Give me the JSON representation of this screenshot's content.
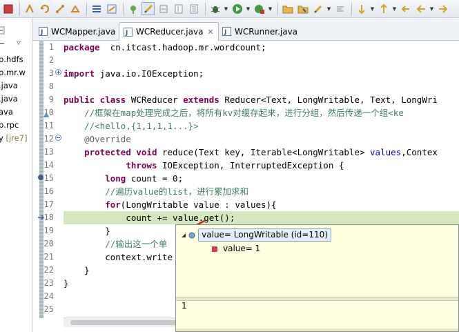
{
  "toolbar": {
    "icons": [
      "stop-icon",
      "build-icon",
      "refresh-icon",
      "link-icon",
      "debug-icon",
      "build-all-icon",
      "skip-breakpoints-icon",
      "toggle-comment-icon",
      "run-icon",
      "run-external-icon",
      "open-type-icon",
      "open-task-icon",
      "search-icon",
      "mark-occurrences-icon",
      "next-annotation-icon",
      "previous-annotation-icon",
      "back-icon",
      "forward-icon"
    ]
  },
  "explorer": {
    "items": [
      {
        "label": "p.hdfs",
        "suffix": ""
      },
      {
        "label": "p.mr.w",
        "suffix": ""
      },
      {
        "label": ".java",
        "suffix": ""
      },
      {
        "label": ".java",
        "suffix": ""
      },
      {
        "label": "ava",
        "suffix": ""
      },
      {
        "label": "p.rpc",
        "suffix": ""
      },
      {
        "label": "y ",
        "suffix": "[jre7]"
      }
    ]
  },
  "tabs": [
    {
      "label": "WCMapper.java",
      "active": false
    },
    {
      "label": "WCReducer.java",
      "active": true,
      "close": "✕"
    },
    {
      "label": "WCRunner.java",
      "active": false
    }
  ],
  "editor": {
    "line_numbers": [
      "1",
      "2",
      "3",
      "8",
      "9",
      "10",
      "11",
      "12",
      "13",
      "14",
      "15",
      "16",
      "17",
      "18",
      "19",
      "20",
      "21",
      "22",
      "23",
      "24",
      "25"
    ],
    "lines": [
      {
        "n": "1",
        "parts": [
          [
            "kw",
            "package"
          ],
          [
            "",
            "  cn.itcast.hadoop.mr.wordcount;"
          ]
        ]
      },
      {
        "n": "2",
        "parts": []
      },
      {
        "n": "3",
        "parts": [
          [
            "kw",
            "import"
          ],
          [
            "",
            " java.io.IOException;"
          ]
        ]
      },
      {
        "n": "8",
        "parts": []
      },
      {
        "n": "9",
        "parts": [
          [
            "kw",
            "public class"
          ],
          [
            "",
            " WCReducer "
          ],
          [
            "kw",
            "extends"
          ],
          [
            "",
            " Reducer<Text, LongWritable, Text, LongWri"
          ]
        ]
      },
      {
        "n": "10",
        "parts": [
          [
            "cm",
            "    //框架在map处理完成之后，将所有kv对缓存起来，进行分组，然后传递一个组<ke"
          ]
        ]
      },
      {
        "n": "11",
        "parts": [
          [
            "cm",
            "    //<hello,{1,1,1,1...}>"
          ]
        ]
      },
      {
        "n": "12",
        "parts": [
          [
            "an",
            "    @Override"
          ]
        ]
      },
      {
        "n": "13",
        "parts": [
          [
            "",
            "    "
          ],
          [
            "kw",
            "protected void"
          ],
          [
            "",
            " reduce(Text key, Iterable<LongWritable> "
          ],
          [
            "fld",
            "values"
          ],
          [
            "",
            ",Contex"
          ]
        ]
      },
      {
        "n": "14",
        "parts": [
          [
            "",
            "            "
          ],
          [
            "kw",
            "throws"
          ],
          [
            "",
            " IOException, InterruptedException {"
          ]
        ]
      },
      {
        "n": "15",
        "parts": [
          [
            "",
            "        "
          ],
          [
            "kw",
            "long"
          ],
          [
            "",
            " count = 0;"
          ]
        ]
      },
      {
        "n": "16",
        "parts": [
          [
            "cm",
            "        //遍历value的list，进行累加求和"
          ]
        ]
      },
      {
        "n": "17",
        "parts": [
          [
            "",
            "        "
          ],
          [
            "kw",
            "for"
          ],
          [
            "",
            "(LongWritable value : values){"
          ]
        ]
      },
      {
        "n": "18",
        "parts": [
          [
            "",
            "            count += value.get();"
          ]
        ]
      },
      {
        "n": "19",
        "parts": [
          [
            "",
            "        }"
          ]
        ]
      },
      {
        "n": "20",
        "parts": [
          [
            "cm",
            "        //输出这一个单"
          ]
        ]
      },
      {
        "n": "21",
        "parts": [
          [
            "",
            "        context.write"
          ]
        ]
      },
      {
        "n": "22",
        "parts": [
          [
            "",
            "    }"
          ]
        ]
      },
      {
        "n": "23",
        "parts": [
          [
            "",
            "}"
          ]
        ]
      },
      {
        "n": "24",
        "parts": []
      },
      {
        "n": "25",
        "parts": []
      }
    ]
  },
  "popup": {
    "root_label": "value= LongWritable  (id=110)",
    "child_label": "value= 1",
    "detail_value": "1"
  }
}
